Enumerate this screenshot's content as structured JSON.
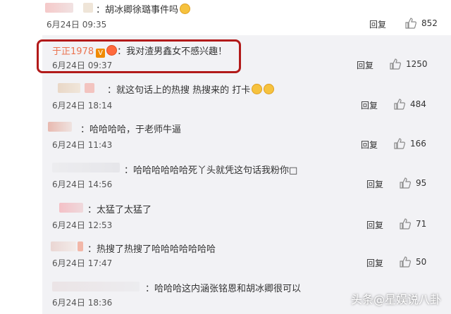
{
  "top_comment": {
    "text": "：胡冰卿徐璐事件吗",
    "time": "6月24日 09:35",
    "reply_label": "回复",
    "likes": "852"
  },
  "replies": [
    {
      "username": "于正1978",
      "text": "：我对渣男鑫女不感兴趣！",
      "time": "6月24日 09:37",
      "reply_label": "回复",
      "likes": "1250"
    },
    {
      "text": "：就这句话上的热搜 热搜来的 打卡",
      "time": "6月24日 18:14",
      "reply_label": "回复",
      "likes": "484"
    },
    {
      "text": "：哈哈哈哈，于老师牛逼",
      "time": "6月24日 11:43",
      "reply_label": "回复",
      "likes": "166"
    },
    {
      "text": "：哈哈哈哈哈哈死丫头就凭这句话我粉你□",
      "time": "6月24日 14:56",
      "reply_label": "回复",
      "likes": "95"
    },
    {
      "text": "：太猛了太猛了",
      "time": "6月24日 12:53",
      "reply_label": "回复",
      "likes": "71"
    },
    {
      "text": "：热搜了热搜了哈哈哈哈哈哈哈",
      "time": "6月24日 17:47",
      "reply_label": "回复",
      "likes": "50"
    },
    {
      "text": "：哈哈哈这内涵张铭恩和胡冰卿很可以",
      "time": "6月24日 18:36"
    }
  ],
  "watermark": "头条@星娱说八卦",
  "colors": {
    "username": "#eb7350",
    "highlight": "#b21a1a",
    "panel": "#f2f2f5"
  }
}
